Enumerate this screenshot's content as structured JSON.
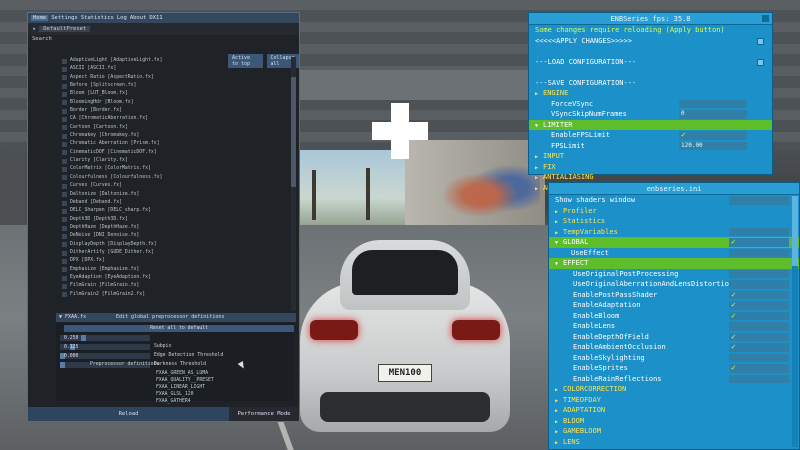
{
  "reshade": {
    "menu": [
      "Home",
      "Settings",
      "Statistics",
      "Log",
      "About",
      "DX11"
    ],
    "preset_name": "DefaultPreset",
    "search_label": "Search",
    "active_to_top": "Active to top",
    "collapse_all": "Collapse all",
    "effects": [
      "AdaptiveLight [AdaptiveLight.fx]",
      "ASCII [ASCII.fx]",
      "Aspect Ratio [AspectRatio.fx]",
      "Before [Splitscreen.fx]",
      "Bloom [LUT_Bloom.fx]",
      "BloomingHdr [Bloom.fx]",
      "Border [Border.fx]",
      "CA [ChromaticAberration.fx]",
      "Cartoon [Cartoon.fx]",
      "Chromakey [Chromakey.fx]",
      "Chromatic Aberration [Prism.fx]",
      "CinematicDOF [CinematicDOF.fx]",
      "Clarity [Clarity.fx]",
      "ColorMatrix [ColorMatrix.fx]",
      "Colourfulness [Colourfulness.fx]",
      "Curves [Curves.fx]",
      "Daltonize [Daltonize.fx]",
      "Deband [Deband.fx]",
      "DELC_Sharpen [DELC_sharp.fx]",
      "Depth3D [Depth3D.fx]",
      "DepthHaze [DepthHaze.fx]",
      "DeNoise [DNI_Denoise.fx]",
      "DisplayDepth [DisplayDepth.fx]",
      "DitherArtify [GUDE_Dither.fx]",
      "DPX [DPX.fx]",
      "Emphasize [Emphasize.fx]",
      "EyeAdaption [EyeAdaption.fx]",
      "FilmGrain [FilmGrain.fx]",
      "FilmGrain2 [FilmGrain2.fx]"
    ],
    "section_name": "FXAA.fx",
    "section_title": "Edit global preprocessor definitions",
    "reset_label": "Reset all to default",
    "params": [
      {
        "value": "0.250",
        "label": "",
        "pos": 0.25
      },
      {
        "value": "0.125",
        "label": "Subpix",
        "pos": 0.12
      },
      {
        "value": "0.000",
        "label": "Edge Detection Threshold",
        "pos": 0.0
      },
      {
        "value": "",
        "label": "Darkness Threshold",
        "pos": 0.0
      }
    ],
    "preproc_label": "Preprocessor definitions",
    "macros": [
      "FXAA_GREEN_AS_LUMA",
      "FXAA_QUALITY__PRESET",
      "FXAA_LINEAR_LIGHT",
      "FXAA_GLSL_120",
      "FXAA_GATHER4"
    ],
    "reload_label": "Reload",
    "performance_label": "Performance Mode"
  },
  "enb_top": {
    "title": "ENBSeries  fps: 35.8",
    "rows": [
      {
        "text": "Some changes require reloading (Apply button)",
        "style": "green"
      },
      {
        "text": "<<<<<APPLY CHANGES>>>>>",
        "style": "",
        "box": true
      },
      {
        "text": "",
        "style": ""
      },
      {
        "text": "---LOAD CONFIGURATION---",
        "style": "",
        "box": true
      },
      {
        "text": "",
        "style": ""
      },
      {
        "text": "---SAVE CONFIGURATION---",
        "style": ""
      },
      {
        "text": "ENGINE",
        "style": "yellow",
        "arrow": true
      },
      {
        "text": "ForceVSync",
        "style": "sub",
        "field": ""
      },
      {
        "text": "VSyncSkipNumFrames",
        "style": "sub",
        "field": "0"
      },
      {
        "text": "LIMITER",
        "style": "sel",
        "arrow": true
      },
      {
        "text": "EnableFPSLimit",
        "style": "sub",
        "check": true
      },
      {
        "text": "FPSLimit",
        "style": "sub",
        "field": "120.00"
      },
      {
        "text": "INPUT",
        "style": "yellow",
        "arrow": true
      },
      {
        "text": "FIX",
        "style": "yellow",
        "arrow": true
      },
      {
        "text": "ANTIALIASING",
        "style": "yellow",
        "arrow": true
      },
      {
        "text": "ADAPTIVEQUALITY",
        "style": "yellow",
        "arrow": true
      }
    ]
  },
  "enb_bottom": {
    "title": "enbseries.ini",
    "rows": [
      {
        "text": "Show shaders window",
        "style": "",
        "field": true
      },
      {
        "text": "Profiler",
        "style": "yellow",
        "arrow": true
      },
      {
        "text": "Statistics",
        "style": "yellow",
        "arrow": true
      },
      {
        "text": "TempVariables",
        "style": "yellow",
        "arrow": true,
        "field": true
      },
      {
        "text": "GLOBAL",
        "style": "sel",
        "arrow": true,
        "check": true
      },
      {
        "text": "UseEffect",
        "style": "sub",
        "field": true
      },
      {
        "text": "EFFECT",
        "style": "sel",
        "arrow": true
      },
      {
        "text": "UseOriginalPostProcessing",
        "style": "sub2",
        "field": true
      },
      {
        "text": "UseOriginalAberrationAndLensDistortion",
        "style": "sub2",
        "field": true
      },
      {
        "text": "EnablePostPassShader",
        "style": "sub2",
        "check": true
      },
      {
        "text": "EnableAdaptation",
        "style": "sub2",
        "check": true
      },
      {
        "text": "EnableBloom",
        "style": "sub2",
        "check": true
      },
      {
        "text": "EnableLens",
        "style": "sub2",
        "field": true
      },
      {
        "text": "EnableDepthOfField",
        "style": "sub2",
        "check": true
      },
      {
        "text": "EnableAmbientOcclusion",
        "style": "sub2",
        "check": true
      },
      {
        "text": "EnableSkylighting",
        "style": "sub2",
        "field": true
      },
      {
        "text": "EnableSprites",
        "style": "sub2",
        "check": true
      },
      {
        "text": "EnableRainReflections",
        "style": "sub2",
        "field": true
      },
      {
        "text": "COLORCORRECTION",
        "style": "yellow",
        "arrow": true
      },
      {
        "text": "TIMEOFDAY",
        "style": "yellow",
        "arrow": true
      },
      {
        "text": "ADAPTATION",
        "style": "yellow",
        "arrow": true
      },
      {
        "text": "BLOOM",
        "style": "yellow",
        "arrow": true
      },
      {
        "text": "GAMEBLOOM",
        "style": "yellow",
        "arrow": true
      },
      {
        "text": "LENS",
        "style": "yellow",
        "arrow": true
      },
      {
        "text": "GAMELENS",
        "style": "yellow",
        "arrow": true
      },
      {
        "text": "CAMERAVOLUMETRICRAYS",
        "style": "yellow",
        "arrow": true
      }
    ]
  },
  "scene": {
    "plate": "MEN100"
  }
}
